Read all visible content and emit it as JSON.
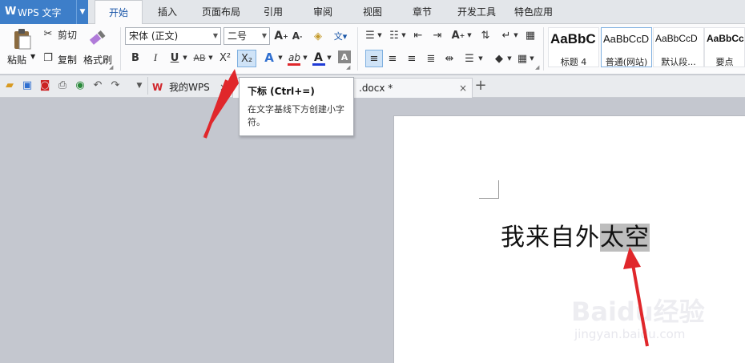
{
  "app": {
    "title": "WPS 文字",
    "logo": "W"
  },
  "menu_tabs": [
    "开始",
    "插入",
    "页面布局",
    "引用",
    "审阅",
    "视图",
    "章节",
    "开发工具",
    "特色应用"
  ],
  "clipboard": {
    "paste": "粘贴",
    "cut": "剪切",
    "copy": "复制",
    "format_painter": "格式刷"
  },
  "font": {
    "name": "宋体 (正文)",
    "size": "二号"
  },
  "styles": [
    {
      "preview": "AaBbC",
      "name": "标题 4"
    },
    {
      "preview": "AaBbCcD",
      "name": "普通(网站)"
    },
    {
      "preview": "AaBbCcD",
      "name": "默认段..."
    },
    {
      "preview": "AaBbCc",
      "name": "要点"
    }
  ],
  "format_buttons": {
    "bold": "B",
    "italic": "I",
    "underline": "U",
    "strike": "AB",
    "superscript": "X²",
    "subscript": "X₂"
  },
  "doc_tabs": {
    "my_wps": "我的WPS",
    "current_doc": ".docx *"
  },
  "tooltip": {
    "title": "下标 (Ctrl+=)",
    "description": "在文字基线下方创建小字符。"
  },
  "document": {
    "text_before": "我来自外",
    "text_selected": "太空"
  },
  "watermark": {
    "main": "Baidu经验",
    "sub": "jingyan.baidu.com"
  },
  "colors": {
    "accent": "#3d7ec9",
    "selection": "#bdbdbd",
    "arrow": "#e0272b",
    "font_color_bar": "#1f3bd6",
    "highlight_bar": "#e0272b"
  }
}
